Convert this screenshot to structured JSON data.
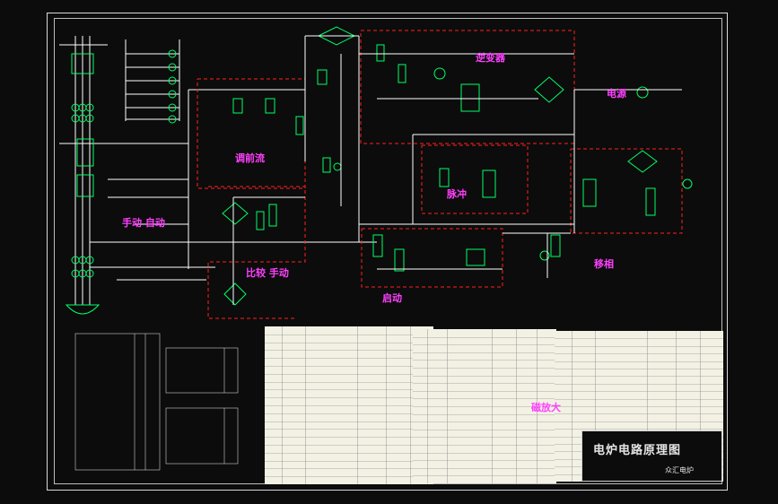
{
  "drawing": {
    "title": "电炉电路原理图",
    "company": "众汇电炉"
  },
  "section_labels": {
    "current_loop": "调前流",
    "inverter": "逆变器",
    "manual_auto": "手动 自动",
    "compare_manual": "比较 手动",
    "pulse": "脉冲",
    "phase_shift": "移相",
    "start_circuit": "启动",
    "power_supply": "电源",
    "excitation": "磁放大"
  },
  "colors": {
    "background": "#0c0c0c",
    "wire": "#ffffff",
    "component": "#00ff66",
    "boundary": "#ff2020",
    "label": "#ff40ff",
    "table_paper": "#f3f1e4"
  }
}
